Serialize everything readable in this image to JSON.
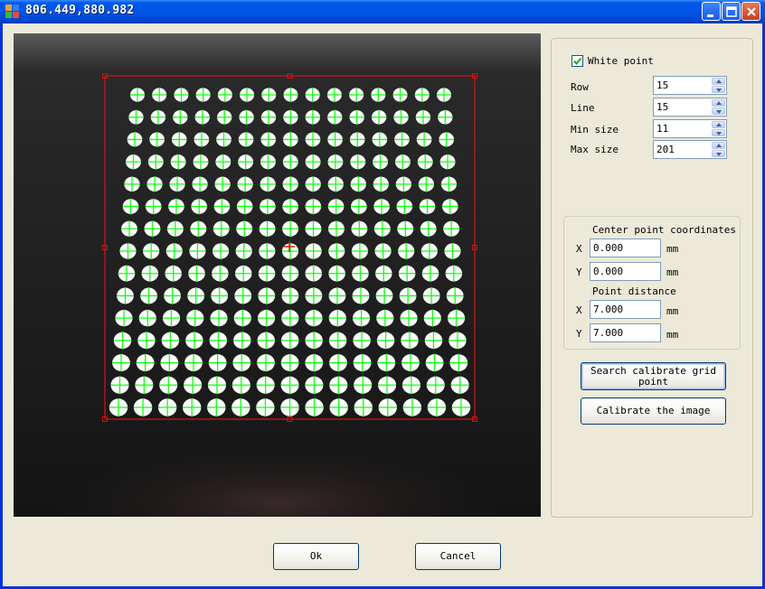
{
  "window": {
    "title": "806.449,880.982",
    "icon": "app-grid-icon"
  },
  "titlebar_buttons": {
    "minimize_icon": "minimize-icon",
    "maximize_icon": "maximize-icon",
    "close_icon": "close-icon"
  },
  "settings": {
    "white_point_label": "White point",
    "white_point_checked": true,
    "row_label": "Row",
    "row_value": "15",
    "line_label": "Line",
    "line_value": "15",
    "min_size_label": "Min size",
    "min_size_value": "11",
    "max_size_label": "Max size",
    "max_size_value": "201"
  },
  "coordinates": {
    "center_title": "Center point coordinates",
    "x_label": "X",
    "x_value": "0.000",
    "y_label": "Y",
    "y_value": "0.000",
    "unit": "mm",
    "distance_title": "Point distance",
    "dx_label": "X",
    "dx_value": "7.000",
    "dy_label": "Y",
    "dy_value": "7.000"
  },
  "buttons": {
    "search": "Search calibrate grid point",
    "calibrate": "Calibrate the image",
    "ok": "Ok",
    "cancel": "Cancel"
  },
  "overlay": {
    "grid_rows": 15,
    "grid_cols": 15,
    "roi_color": "#e01010",
    "marker_color": "#10ff10",
    "dot_color": "#ffffff"
  }
}
